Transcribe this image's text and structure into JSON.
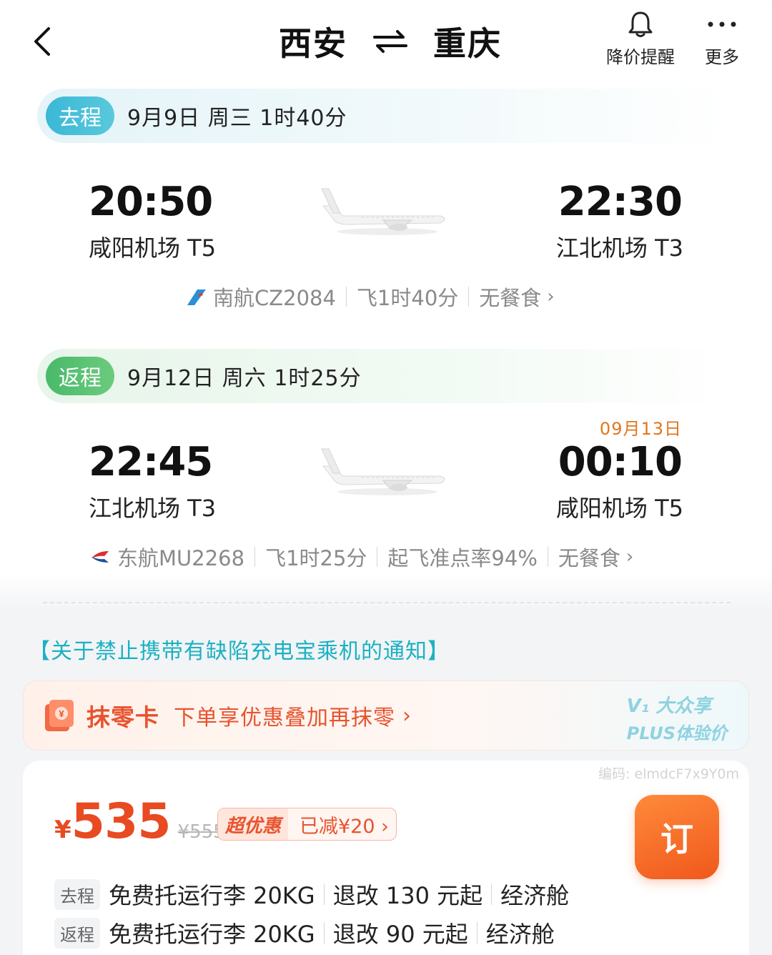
{
  "header": {
    "origin": "西安",
    "destination": "重庆",
    "price_alert_label": "降价提醒",
    "more_label": "更多"
  },
  "outbound": {
    "tag": "去程",
    "date_info": "9月9日 周三  1时40分",
    "dep_time": "20:50",
    "dep_airport": "咸阳机场 T5",
    "arr_time": "22:30",
    "arr_airport": "江北机场 T3",
    "flight_no": "南航CZ2084",
    "duration": "飞1时40分",
    "meal": "无餐食"
  },
  "return": {
    "tag": "返程",
    "date_info": "9月12日 周六  1时25分",
    "dep_time": "22:45",
    "dep_airport": "江北机场 T3",
    "arr_date": "09月13日",
    "arr_time": "00:10",
    "arr_airport": "咸阳机场 T5",
    "flight_no": "东航MU2268",
    "duration": "飞1时25分",
    "on_time_rate": "起飞准点率94%",
    "meal": "无餐食"
  },
  "notice": "【关于禁止携带有缺陷充电宝乘机的通知】",
  "rounding_card": {
    "title": "抹零卡",
    "desc": "下单享优惠叠加再抹零",
    "vip_line1": "V₁ 大众享",
    "vip_line2": "PLUS体验价"
  },
  "price_card": {
    "code": "编码: elmdcF7x9Y0m",
    "currency": "¥",
    "price": "535",
    "original_price": "¥555",
    "promo_tag": "超优惠",
    "promo_discount": "已减¥20",
    "book_label": "订",
    "rows": [
      {
        "tag": "去程",
        "baggage": "免费托运行李 20KG",
        "refund": "退改 130 元起",
        "cabin": "经济舱"
      },
      {
        "tag": "返程",
        "baggage": "免费托运行李 20KG",
        "refund": "退改 90 元起",
        "cabin": "经济舱"
      }
    ]
  },
  "colors": {
    "accent_orange": "#e8532f",
    "teal": "#1bb1c3",
    "next_day": "#e0761e"
  }
}
